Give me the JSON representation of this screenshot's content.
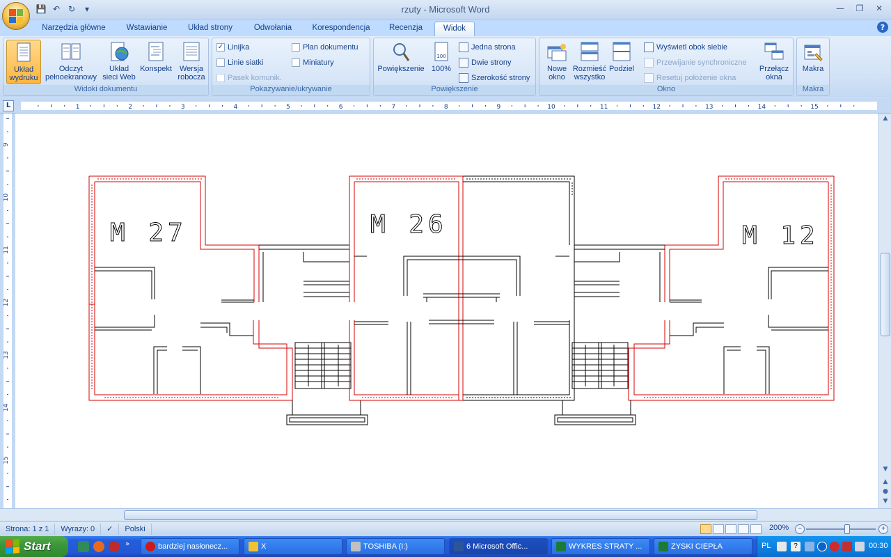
{
  "window": {
    "title": "rzuty - Microsoft Word"
  },
  "tabs": [
    {
      "label": "Narzędzia główne"
    },
    {
      "label": "Wstawianie"
    },
    {
      "label": "Układ strony"
    },
    {
      "label": "Odwołania"
    },
    {
      "label": "Korespondencja"
    },
    {
      "label": "Recenzja"
    },
    {
      "label": "Widok",
      "active": true
    }
  ],
  "ribbon": {
    "groups": {
      "views": {
        "label": "Widoki dokumentu",
        "buttons": [
          {
            "label": "Układ wydruku",
            "active": true
          },
          {
            "label": "Odczyt pełnoekranowy"
          },
          {
            "label": "Układ sieci Web"
          },
          {
            "label": "Konspekt"
          },
          {
            "label": "Wersja robocza"
          }
        ]
      },
      "show": {
        "label": "Pokazywanie/ukrywanie",
        "items": [
          {
            "label": "Linijka",
            "checked": true
          },
          {
            "label": "Linie siatki",
            "checked": false
          },
          {
            "label": "Pasek komunik.",
            "checked": false,
            "disabled": true
          },
          {
            "label": "Plan dokumentu",
            "checked": false
          },
          {
            "label": "Miniatury",
            "checked": false
          }
        ]
      },
      "zoom": {
        "label": "Powiększenie",
        "zoom_button": "Powiększenie",
        "pct_button": "100%",
        "one_page": "Jedna strona",
        "two_pages": "Dwie strony",
        "page_width": "Szerokość strony"
      },
      "window": {
        "label": "Okno",
        "new_window": "Nowe okno",
        "arrange_all": "Rozmieść wszystko",
        "split": "Podziel",
        "side_by_side": "Wyświetl obok siebie",
        "sync_scroll": "Przewijanie synchroniczne",
        "reset_pos": "Resetuj położenie okna",
        "switch_windows": "Przełącz okna"
      },
      "macros": {
        "label": "Makra",
        "button": "Makra"
      }
    }
  },
  "ruler": {
    "horizontal_numbers": [
      "1",
      "2",
      "3",
      "4",
      "5",
      "6",
      "7",
      "8",
      "9",
      "10",
      "11",
      "12",
      "13",
      "14",
      "15"
    ],
    "vertical_numbers": [
      "9",
      "10",
      "11",
      "12",
      "13",
      "14",
      "15"
    ]
  },
  "document": {
    "apartment_labels": [
      "M 27",
      "M 26",
      "M 12"
    ]
  },
  "statusbar": {
    "page": "Strona: 1 z 1",
    "words": "Wyrazy: 0",
    "language": "Polski",
    "zoom": "200%"
  },
  "taskbar": {
    "start": "Start",
    "tasks": [
      {
        "label": "bardziej nasłonecz...",
        "icon_color": "#cc1a1a"
      },
      {
        "label": "X",
        "icon_color": "#f1c232"
      },
      {
        "label": "TOSHIBA (I:)",
        "icon_color": "#c0c0c0"
      },
      {
        "label": "6 Microsoft Offic...",
        "icon_color": "#2b579a",
        "active": true
      },
      {
        "label": "WYKRES STRATY ...",
        "icon_color": "#1d7a36"
      },
      {
        "label": "ZYSKI CIEPŁA",
        "icon_color": "#1d7a36"
      }
    ],
    "tray": {
      "lang": "PL",
      "clock": "00:30"
    }
  },
  "colors": {
    "wall_red": "#d40000",
    "wall_black": "#000000",
    "accent": "#ffb53f"
  }
}
